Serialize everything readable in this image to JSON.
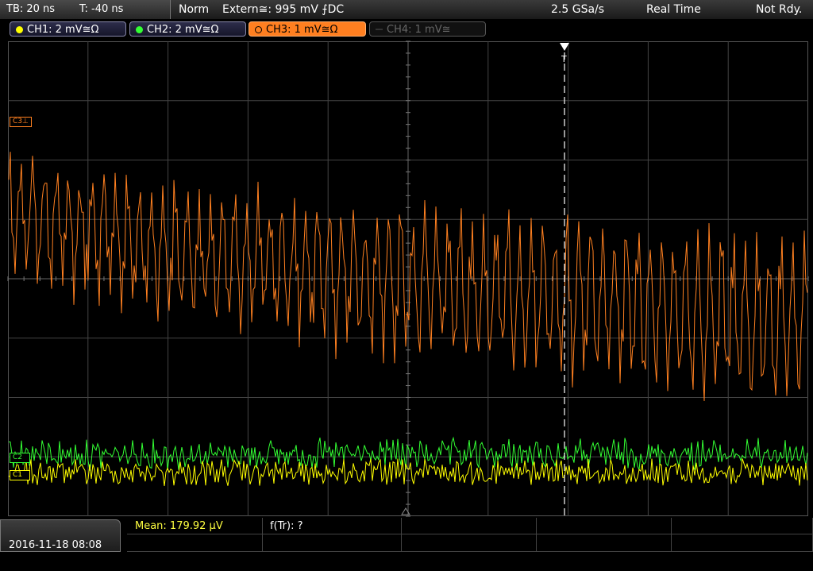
{
  "status": {
    "timebase": "TB: 20 ns",
    "trigger_offset": "T: -40 ns",
    "trigger_mode": "Norm",
    "trigger_source": "Extern≅: 995 mV ⨍DC",
    "sample_rate": "2.5 GSa/s",
    "acq_mode": "Real Time",
    "state": "Not Rdy."
  },
  "channels": [
    {
      "label": "CH1: 2 mV≅Ω",
      "color": "#ffff00",
      "state": "on"
    },
    {
      "label": "CH2: 2 mV≅Ω",
      "color": "#33ff33",
      "state": "on"
    },
    {
      "label": "CH3: 1 mV≅Ω",
      "color": "#ff8020",
      "state": "active"
    },
    {
      "label": "CH4: 1 mV≅",
      "color": "#666666",
      "state": "off"
    }
  ],
  "markers": {
    "c3": "C3",
    "c2": "C2",
    "c1": "C1",
    "trigger": "T"
  },
  "measurements": {
    "mean": "Mean: 179.92 µV",
    "freq": "f(Tr): ?"
  },
  "datetime": "2016-11-18 08:08",
  "colors": {
    "ch1": "#ffff00",
    "ch2": "#33ff33",
    "ch3": "#ff8020",
    "grid": "#555555"
  }
}
